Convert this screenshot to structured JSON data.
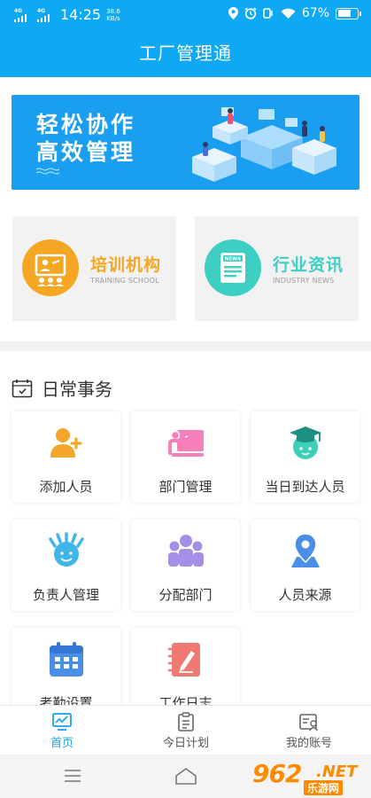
{
  "status_bar": {
    "network_1": "4G",
    "network_2": "4G",
    "time": "14:25",
    "speed_value": "38.6",
    "speed_unit": "KB/s",
    "battery": "67%"
  },
  "header": {
    "title": "工厂管理通"
  },
  "banner": {
    "line1": "轻松协作",
    "line2": "高效管理"
  },
  "feature_cards": [
    {
      "title": "培训机构",
      "subtitle": "TRAINING SCHOOL",
      "color": "#f5a623",
      "icon": "classroom-icon"
    },
    {
      "title": "行业资讯",
      "subtitle": "INDUSTRY NEWS",
      "color": "#3dcfc2",
      "icon": "newspaper-icon",
      "icon_text": "NEWS"
    }
  ],
  "daily": {
    "title": "日常事务",
    "items": [
      {
        "label": "添加人员",
        "icon": "add-person-icon",
        "color": "#f4a52b"
      },
      {
        "label": "部门管理",
        "icon": "department-board-icon",
        "color": "#f57fb8"
      },
      {
        "label": "当日到达人员",
        "icon": "graduate-icon",
        "color": "#3ccfb9"
      },
      {
        "label": "负责人管理",
        "icon": "manager-icon",
        "color": "#3fb5ea"
      },
      {
        "label": "分配部门",
        "icon": "group-icon",
        "color": "#a58ee6"
      },
      {
        "label": "人员来源",
        "icon": "location-pin-icon",
        "color": "#4a8ee8"
      },
      {
        "label": "考勤设置",
        "icon": "calendar-icon",
        "color": "#4a8ee8"
      },
      {
        "label": "工作日志",
        "icon": "notebook-icon",
        "color": "#f07a72"
      }
    ]
  },
  "tabbar": {
    "tabs": [
      {
        "label": "首页",
        "active": true,
        "icon": "home-chart-icon"
      },
      {
        "label": "今日计划",
        "active": false,
        "icon": "clipboard-icon"
      },
      {
        "label": "我的账号",
        "active": false,
        "icon": "account-card-icon"
      }
    ],
    "accent": "#19a3ec"
  },
  "watermark": {
    "number": "962",
    "domain": ".NET",
    "text": "乐游网"
  },
  "colors": {
    "primary": "#0fa8f2",
    "banner": "#1a9ff0"
  }
}
